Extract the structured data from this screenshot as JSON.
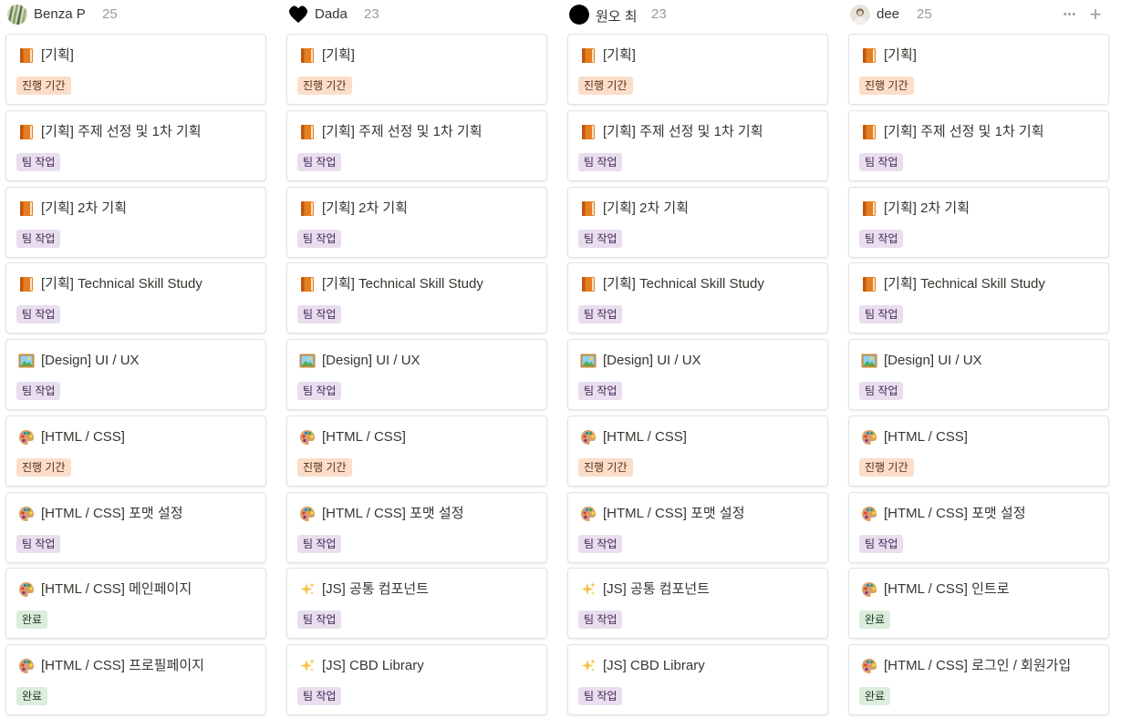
{
  "colors": {
    "진행 기간": {
      "bg": "#fadec9",
      "fg": "#5a2f16"
    },
    "팀 작업": {
      "bg": "#e8deee",
      "fg": "#412454"
    },
    "완료": {
      "bg": "#dbeddb",
      "fg": "#1c3829"
    }
  },
  "columns": [
    {
      "name": "Benza P",
      "count": "25",
      "avatar": "photo-avatar",
      "cards": [
        {
          "icon": "book-icon",
          "title": "[기획]",
          "tag": "진행 기간"
        },
        {
          "icon": "book-icon",
          "title": "[기획] 주제 선정 및 1차 기획",
          "tag": "팀 작업"
        },
        {
          "icon": "book-icon",
          "title": "[기획] 2차 기획",
          "tag": "팀 작업"
        },
        {
          "icon": "book-icon",
          "title": "[기획] Technical Skill Study",
          "tag": "팀 작업"
        },
        {
          "icon": "picture-icon",
          "title": "[Design] UI / UX",
          "tag": "팀 작업"
        },
        {
          "icon": "palette-icon",
          "title": "[HTML / CSS]",
          "tag": "진행 기간"
        },
        {
          "icon": "palette-icon",
          "title": "[HTML / CSS]  포맷 설정",
          "tag": "팀 작업"
        },
        {
          "icon": "palette-icon",
          "title": "[HTML / CSS] 메인페이지",
          "tag": "완료"
        },
        {
          "icon": "palette-icon",
          "title": "[HTML / CSS] 프로필페이지",
          "tag": "완료"
        }
      ]
    },
    {
      "name": "Dada",
      "count": "23",
      "avatar": "heart-avatar",
      "cards": [
        {
          "icon": "book-icon",
          "title": "[기획]",
          "tag": "진행 기간"
        },
        {
          "icon": "book-icon",
          "title": "[기획] 주제 선정 및 1차 기획",
          "tag": "팀 작업"
        },
        {
          "icon": "book-icon",
          "title": "[기획] 2차 기획",
          "tag": "팀 작업"
        },
        {
          "icon": "book-icon",
          "title": "[기획] Technical Skill Study",
          "tag": "팀 작업"
        },
        {
          "icon": "picture-icon",
          "title": "[Design] UI / UX",
          "tag": "팀 작업"
        },
        {
          "icon": "palette-icon",
          "title": "[HTML / CSS]",
          "tag": "진행 기간"
        },
        {
          "icon": "palette-icon",
          "title": "[HTML / CSS]  포맷 설정",
          "tag": "팀 작업"
        },
        {
          "icon": "sparkles-icon",
          "title": "[JS] 공통 컴포넌트",
          "tag": "팀 작업"
        },
        {
          "icon": "sparkles-icon",
          "title": "[JS] CBD Library",
          "tag": "팀 작업"
        }
      ]
    },
    {
      "name": "원오 최",
      "count": "23",
      "avatar": "black-circle-avatar",
      "cards": [
        {
          "icon": "book-icon",
          "title": "[기획]",
          "tag": "진행 기간"
        },
        {
          "icon": "book-icon",
          "title": "[기획] 주제 선정 및 1차 기획",
          "tag": "팀 작업"
        },
        {
          "icon": "book-icon",
          "title": "[기획] 2차 기획",
          "tag": "팀 작업"
        },
        {
          "icon": "book-icon",
          "title": "[기획] Technical Skill Study",
          "tag": "팀 작업"
        },
        {
          "icon": "picture-icon",
          "title": "[Design] UI / UX",
          "tag": "팀 작업"
        },
        {
          "icon": "palette-icon",
          "title": "[HTML / CSS]",
          "tag": "진행 기간"
        },
        {
          "icon": "palette-icon",
          "title": "[HTML / CSS]  포맷 설정",
          "tag": "팀 작업"
        },
        {
          "icon": "sparkles-icon",
          "title": "[JS] 공통 컴포넌트",
          "tag": "팀 작업"
        },
        {
          "icon": "sparkles-icon",
          "title": "[JS] CBD Library",
          "tag": "팀 작업"
        }
      ]
    },
    {
      "name": "dee",
      "count": "25",
      "avatar": "person-avatar",
      "cards": [
        {
          "icon": "book-icon",
          "title": "[기획]",
          "tag": "진행 기간"
        },
        {
          "icon": "book-icon",
          "title": "[기획] 주제 선정 및 1차 기획",
          "tag": "팀 작업"
        },
        {
          "icon": "book-icon",
          "title": "[기획] 2차 기획",
          "tag": "팀 작업"
        },
        {
          "icon": "book-icon",
          "title": "[기획] Technical Skill Study",
          "tag": "팀 작업"
        },
        {
          "icon": "picture-icon",
          "title": "[Design] UI / UX",
          "tag": "팀 작업"
        },
        {
          "icon": "palette-icon",
          "title": "[HTML / CSS]",
          "tag": "진행 기간"
        },
        {
          "icon": "palette-icon",
          "title": "[HTML / CSS]  포맷 설정",
          "tag": "팀 작업"
        },
        {
          "icon": "palette-icon",
          "title": "[HTML / CSS] 인트로",
          "tag": "완료"
        },
        {
          "icon": "palette-icon",
          "title": "[HTML / CSS] 로그인 / 회원가입",
          "tag": "완료"
        }
      ]
    }
  ],
  "header_actions": [
    {
      "icon": "more-horizontal-icon",
      "glyph": "•••"
    },
    {
      "icon": "plus-icon",
      "glyph": "+"
    }
  ]
}
